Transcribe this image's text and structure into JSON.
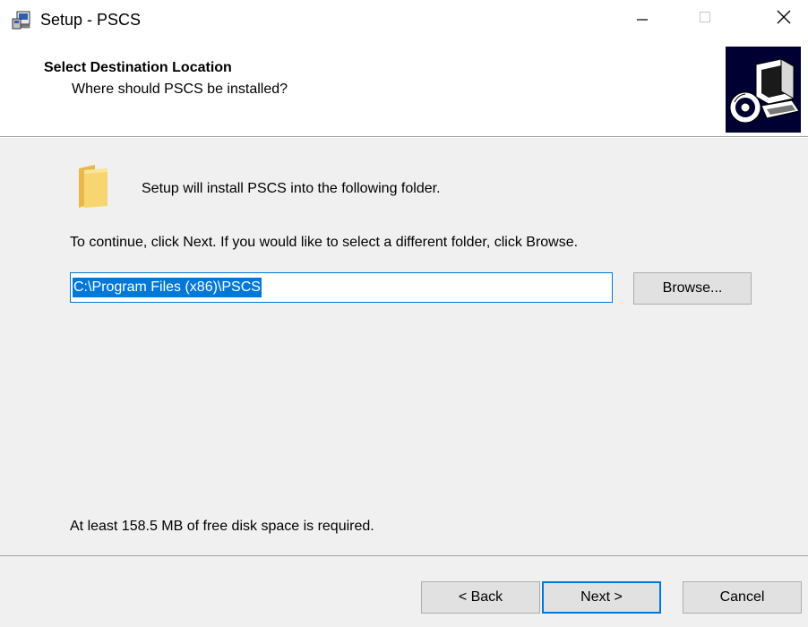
{
  "window": {
    "title": "Setup - PSCS",
    "icons": {
      "app": "setup-icon",
      "minimize": "minimize-icon",
      "maximize": "maximize-icon",
      "close": "close-icon"
    }
  },
  "header": {
    "title": "Select Destination Location",
    "subtitle": "Where should PSCS be installed?",
    "image": "computer-cd-icon"
  },
  "body": {
    "folder_icon": "folder-icon",
    "install_text": "Setup will install PSCS into the following folder.",
    "instruction_text": "To continue, click Next. If you would like to select a different folder, click Browse.",
    "path_value": "C:\\Program Files (x86)\\PSCS",
    "browse_label": "Browse...",
    "disk_space_text": "At least 158.5 MB of free disk space is required."
  },
  "footer": {
    "back_label": "< Back",
    "next_label": "Next >",
    "cancel_label": "Cancel"
  },
  "colors": {
    "accent": "#0078d7",
    "dialog_background": "#f0f0f0",
    "button_background": "#e1e1e1"
  }
}
